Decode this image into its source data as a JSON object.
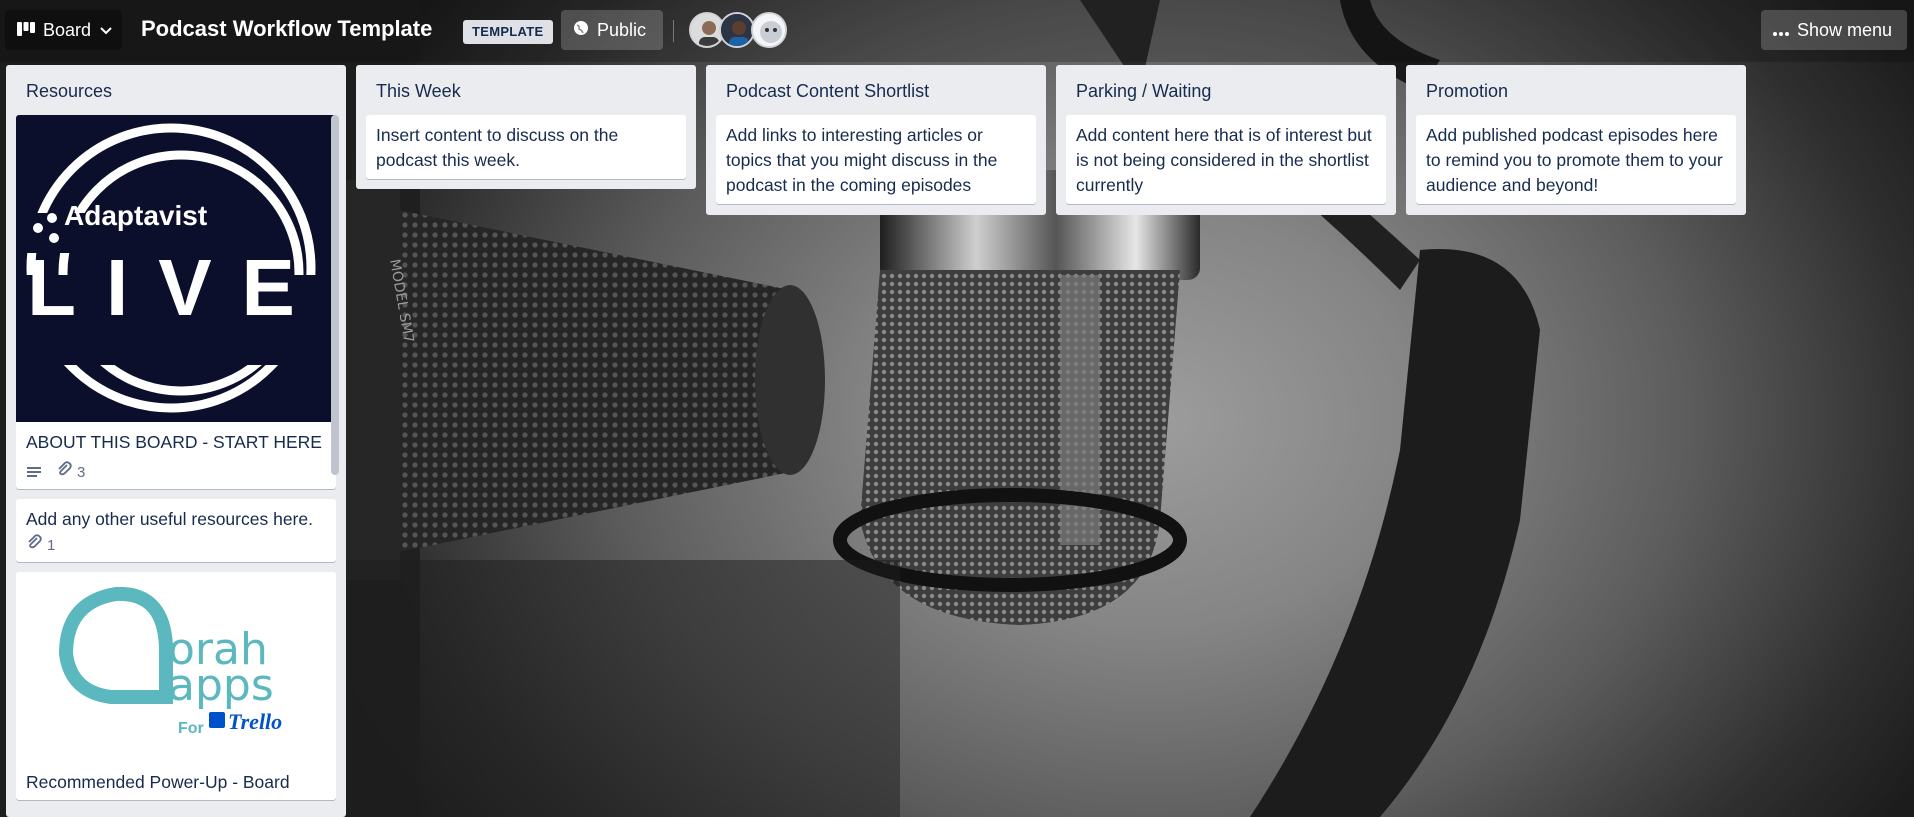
{
  "header": {
    "view_label": "Board",
    "board_title": "Podcast Workflow Template",
    "template_badge": "TEMPLATE",
    "visibility_label": "Public",
    "menu_label": "Show menu"
  },
  "members": [
    {
      "name": "member-1"
    },
    {
      "name": "member-2"
    },
    {
      "name": "member-3"
    }
  ],
  "lists": [
    {
      "title": "Resources",
      "cards": [
        {
          "title": "ABOUT THIS BOARD - START HERE",
          "cover": "Adaptavist LIVE",
          "cover_brand": "Adaptavist",
          "cover_word": "LIVE",
          "attachments": "3",
          "has_description": true
        },
        {
          "title": "Add any other useful resources here.",
          "attachments": "1"
        },
        {
          "title": "Recommended Power-Up - Board Bows for Trello",
          "cover_brand": "orah apps",
          "cover_sub_1": "orah",
          "cover_sub_2": "apps",
          "cover_for": "For",
          "cover_trello": "Trello"
        }
      ]
    },
    {
      "title": "This Week",
      "cards": [
        {
          "title": "Insert content to discuss on the podcast this week."
        }
      ]
    },
    {
      "title": "Podcast Content Shortlist",
      "cards": [
        {
          "title": "Add links to interesting articles or topics that you might discuss in the podcast in the coming episodes"
        }
      ]
    },
    {
      "title": "Parking / Waiting",
      "cards": [
        {
          "title": "Add content here that is of interest but is not being considered in the shortlist currently"
        }
      ]
    },
    {
      "title": "Promotion",
      "cards": [
        {
          "title": "Add published podcast episodes here to remind you to promote them to your audience and beyond!"
        }
      ]
    }
  ],
  "colors": {
    "list_bg": "#ebecf0",
    "card_bg": "#ffffff",
    "adaptavist_cover": "#0b0f2b",
    "orah_teal": "#5ab8be",
    "trello_blue": "#0052cc"
  }
}
